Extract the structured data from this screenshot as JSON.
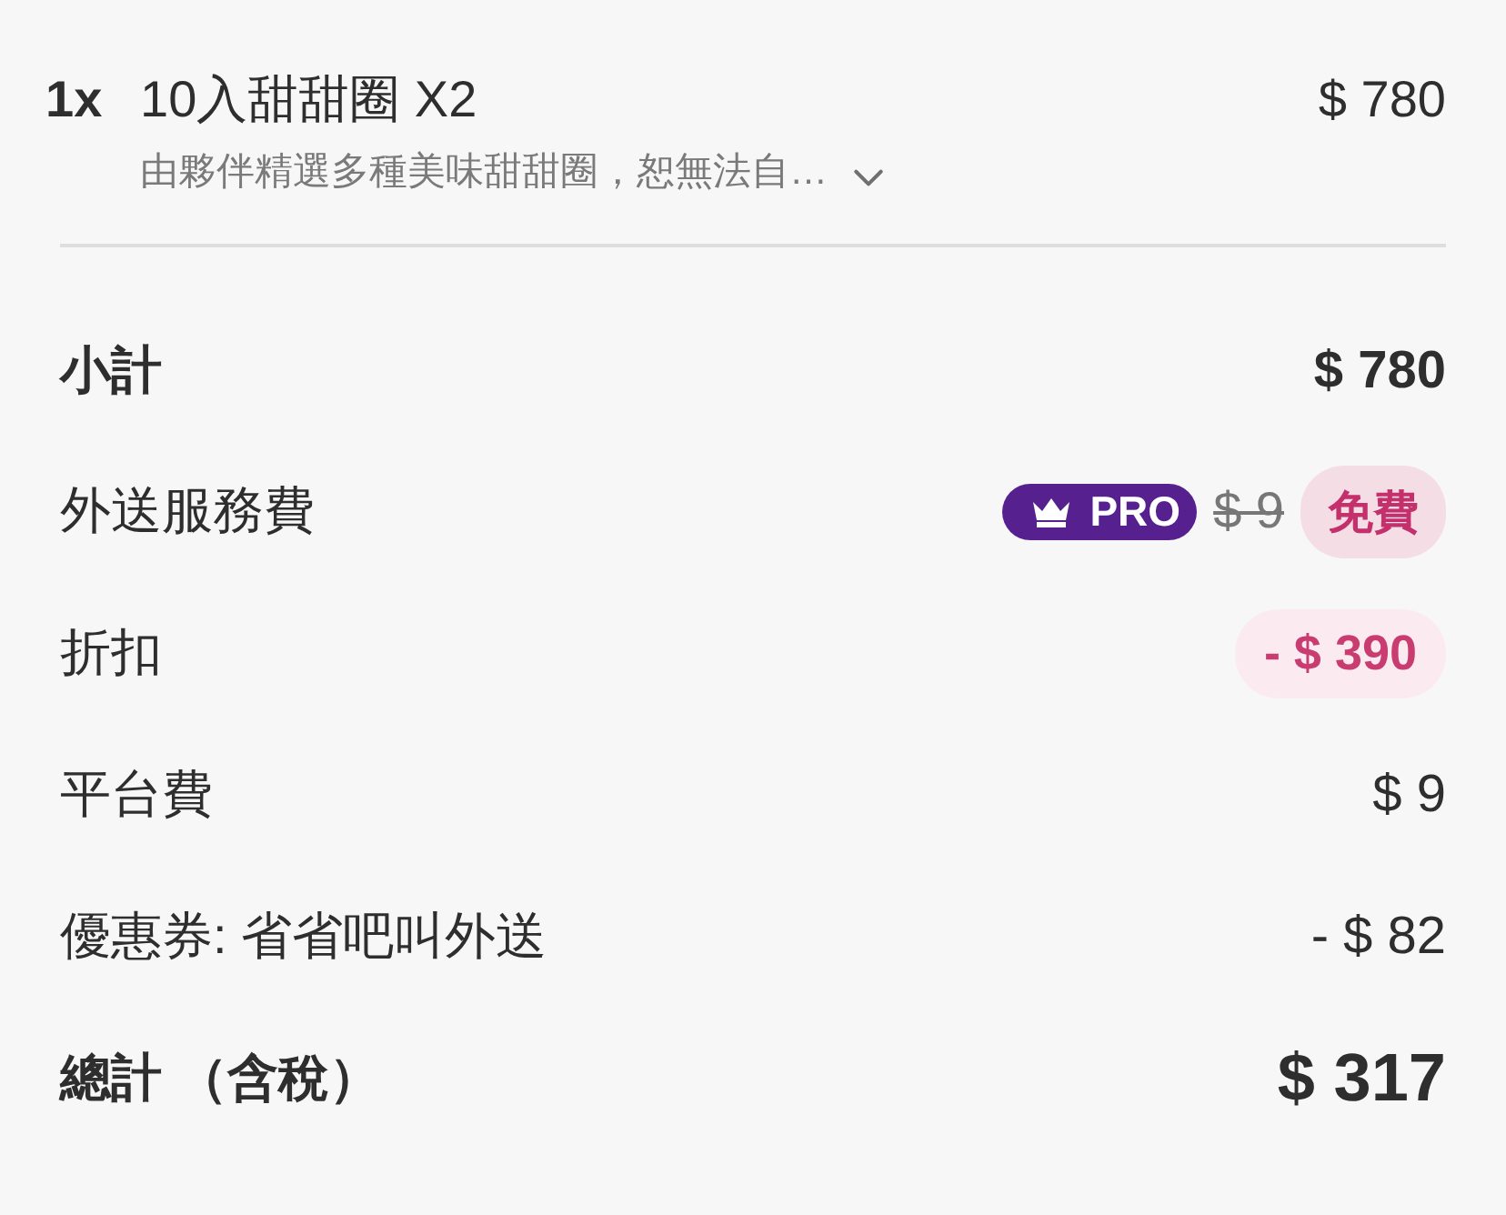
{
  "item": {
    "quantity": "1x",
    "name": "10入甜甜圈 X2",
    "price": "$ 780",
    "description": "由夥伴精選多種美味甜甜圈，恕無法自…",
    "expanded": false
  },
  "summary": [
    {
      "kind": "subtotal",
      "label": "小計",
      "amount": "$ 780"
    },
    {
      "kind": "delivery",
      "label": "外送服務費",
      "badge": "PRO",
      "original_price": "$ 9",
      "amount": "免費"
    },
    {
      "kind": "discount",
      "label": "折扣",
      "amount": "- $ 390"
    },
    {
      "kind": "plain",
      "label": "平台費",
      "amount": "$ 9"
    },
    {
      "kind": "plain",
      "label": "優惠券: 省省吧叫外送",
      "amount": "- $ 82"
    },
    {
      "kind": "total",
      "label": "總計 （含稅）",
      "amount": "$ 317"
    }
  ]
}
